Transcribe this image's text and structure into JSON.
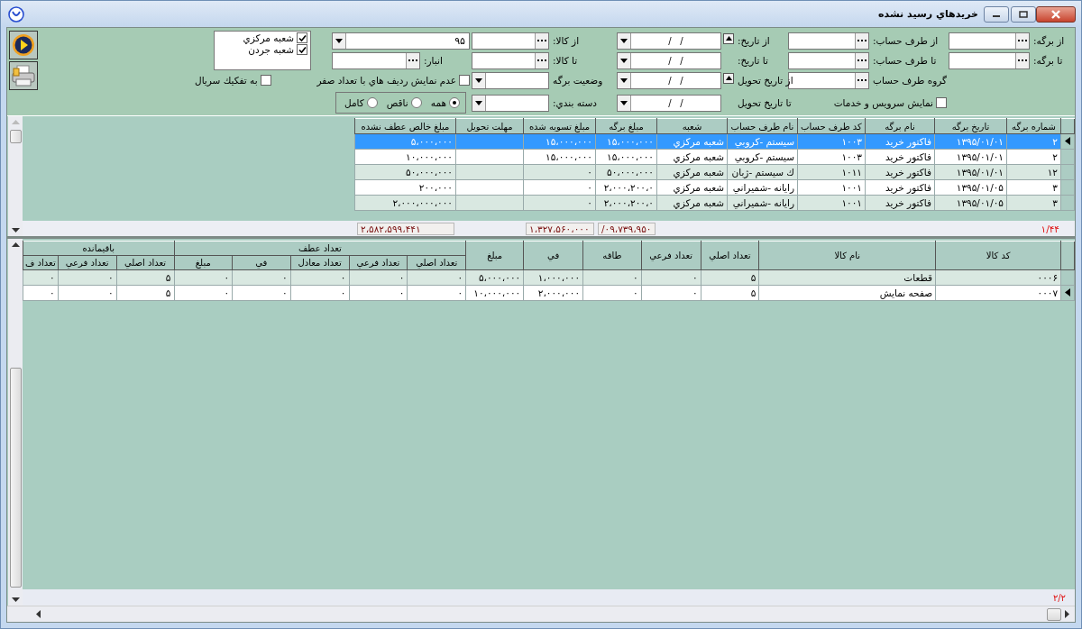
{
  "window": {
    "title": "خريدهاي رسيد نشده"
  },
  "filters": {
    "rows": [
      [
        {
          "kind": "label",
          "text": "از برگه:"
        },
        {
          "kind": "lookup"
        },
        {
          "kind": "label",
          "text": "از طرف حساب:"
        },
        {
          "kind": "lookup"
        },
        {
          "kind": "label",
          "text": "از تاريخ:"
        },
        {
          "kind": "date",
          "value": "/   /",
          "up_button": true
        },
        {
          "kind": "label",
          "text": "از كالا:"
        },
        {
          "kind": "lookup"
        },
        {
          "kind": "combo",
          "value": "۹۵"
        }
      ],
      [
        {
          "kind": "label",
          "text": "تا برگه:"
        },
        {
          "kind": "lookup"
        },
        {
          "kind": "label",
          "text": "تا طرف حساب:"
        },
        {
          "kind": "lookup"
        },
        {
          "kind": "label",
          "text": "تا تاريخ:"
        },
        {
          "kind": "date",
          "value": "/   /",
          "up_button": false
        },
        {
          "kind": "label",
          "text": "تا كالا:"
        },
        {
          "kind": "lookup"
        },
        {
          "kind": "label",
          "text": "انبار:"
        },
        {
          "kind": "lookup"
        }
      ],
      [
        "",
        "",
        {
          "kind": "label",
          "text": "گروه طرف حساب"
        },
        {
          "kind": "lookup"
        },
        {
          "kind": "label",
          "text": "از تاريخ تحويل"
        },
        {
          "kind": "date",
          "value": "/   /",
          "up_button": true
        },
        {
          "kind": "label",
          "text": "وضعيت برگه"
        },
        {
          "kind": "combo"
        },
        {
          "kind": "checkbox",
          "text": "عدم نمايش رديف هاي با تعداد صفر",
          "checked": false
        },
        "",
        {
          "kind": "checkbox",
          "text": "به تفكيك سريال",
          "checked": false
        }
      ],
      [
        "",
        "",
        {
          "kind": "checkbox",
          "text": "نمايش سرويس و خدمات",
          "checked": false
        },
        "",
        {
          "kind": "label",
          "text": "تا تاريخ تحويل"
        },
        {
          "kind": "date",
          "value": "/   /",
          "up_button": false
        },
        {
          "kind": "label",
          "text": "دسته بندي:"
        },
        {
          "kind": "combo"
        },
        {
          "kind": "radio_group",
          "options": [
            {
              "label": "همه",
              "selected": true
            },
            {
              "label": "ناقص",
              "selected": false
            },
            {
              "label": "كامل",
              "selected": false
            }
          ]
        }
      ]
    ]
  },
  "branches": [
    {
      "label": "شعبه مركزي",
      "checked": true
    },
    {
      "label": "شعبه جردن",
      "checked": true
    }
  ],
  "upper_grid": {
    "columns": [
      "شماره برگه",
      "تاريخ برگه",
      "نام برگه",
      "كد طرف حساب",
      "نام طرف حساب",
      "شعبه",
      "مبلغ برگه",
      "مبلغ تسويه شده",
      "مهلت تحويل",
      "مبلغ خالص عطف نشده"
    ],
    "rows": [
      {
        "selected": true,
        "current": true,
        "cells": [
          "۲",
          "۱۳۹۵/۰۱/۰۱",
          "فاكتور خريد",
          "۱۰۰۳",
          "سيستم -كروبي",
          "شعبه مركزي",
          "۱۵،۰۰۰،۰۰۰",
          "۱۵،۰۰۰،۰۰۰",
          "",
          "۵،۰۰۰،۰۰۰"
        ]
      },
      {
        "selected": false,
        "current": false,
        "cells": [
          "۲",
          "۱۳۹۵/۰۱/۰۱",
          "فاكتور خريد",
          "۱۰۰۳",
          "سيستم -كروبي",
          "شعبه مركزي",
          "۱۵،۰۰۰،۰۰۰",
          "۱۵،۰۰۰،۰۰۰",
          "",
          "۱۰،۰۰۰،۰۰۰"
        ]
      },
      {
        "selected": false,
        "current": false,
        "cells": [
          "۱۲",
          "۱۳۹۵/۰۱/۰۱",
          "فاكتور خريد",
          "۱۰۱۱",
          "ك سيستم -ژبان",
          "شعبه مركزي",
          "۵۰،۰۰۰،۰۰۰",
          "۰",
          "",
          "۵۰،۰۰۰،۰۰۰"
        ]
      },
      {
        "selected": false,
        "current": false,
        "cells": [
          "۳",
          "۱۳۹۵/۰۱/۰۵",
          "فاكتور خريد",
          "۱۰۰۱",
          "رايانه -شميراني",
          "شعبه مركزي",
          "۲،۰۰۰،۲۰۰،۰",
          "۰",
          "",
          "۲۰۰،۰۰۰"
        ]
      },
      {
        "selected": false,
        "current": false,
        "cells": [
          "۳",
          "۱۳۹۵/۰۱/۰۵",
          "فاكتور خريد",
          "۱۰۰۱",
          "رايانه -شميراني",
          "شعبه مركزي",
          "۲،۰۰۰،۲۰۰،۰",
          "۰",
          "",
          "۲،۰۰۰،۰۰۰،۰۰۰"
        ]
      }
    ],
    "totals": {
      "page": "۱/۴۴",
      "sheet_amount": "۰۹،۷۳۹،۹۵۰/",
      "settled_amount": "۱،۳۲۷،۵۶۰،۰۰۰",
      "net_amount": "۲،۵۸۲،۵۹۹،۴۴۱"
    }
  },
  "lower_grid": {
    "columns": [
      {
        "label": "كد كالا"
      },
      {
        "label": "نام كالا"
      },
      {
        "label": "تعداد اصلي"
      },
      {
        "label": "تعداد فرعي"
      },
      {
        "label": "طاقه"
      },
      {
        "label": "في"
      },
      {
        "label": "مبلغ"
      },
      {
        "label": "تعداد عطف",
        "colspan": 5,
        "columns": [
          "تعداد اصلي",
          "تعداد فرعي",
          "تعداد معادل",
          "في",
          "مبلغ"
        ]
      },
      {
        "label": "باقيمانده",
        "colspan": 3,
        "columns": [
          "تعداد اصلي",
          "تعداد فرعي",
          "تعداد ف"
        ]
      }
    ],
    "rows": [
      {
        "current": false,
        "cells": [
          "۰۰۰۶",
          "قطعات",
          "۵",
          "۰",
          "۰",
          "۱،۰۰۰،۰۰۰",
          "۵،۰۰۰،۰۰۰",
          "۰",
          "۰",
          "۰",
          "۰",
          "۰",
          "۵",
          "۰",
          "۰"
        ]
      },
      {
        "current": true,
        "cells": [
          "۰۰۰۷",
          "صفحه نمايش",
          "۵",
          "۰",
          "۰",
          "۲،۰۰۰،۰۰۰",
          "۱۰،۰۰۰،۰۰۰",
          "۰",
          "۰",
          "۰",
          "۰",
          "۰",
          "۵",
          "۰",
          "۰"
        ]
      }
    ],
    "page": "۲/۲"
  }
}
